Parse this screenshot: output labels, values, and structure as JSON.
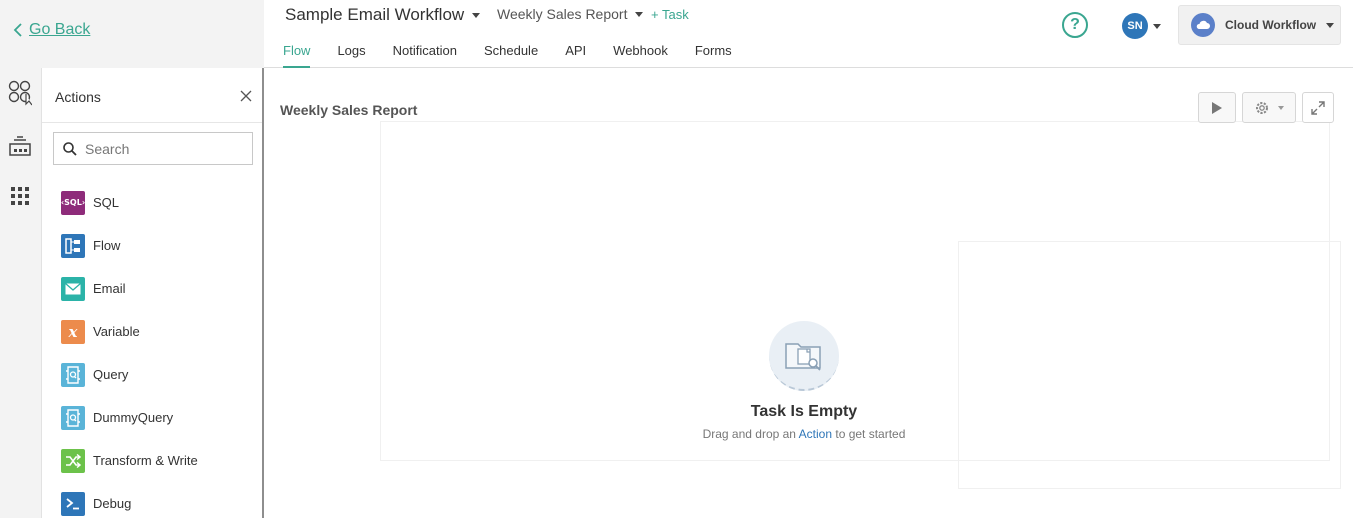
{
  "nav": {
    "go_back": "Go Back"
  },
  "header": {
    "workflow_title": "Sample Email Workflow",
    "report_selector": "Weekly Sales Report",
    "add_task": "+ Task",
    "tabs": [
      "Flow",
      "Logs",
      "Notification",
      "Schedule",
      "API",
      "Webhook",
      "Forms"
    ],
    "active_tab": "Flow",
    "help": "?",
    "user_initials": "SN",
    "cloud_label": "Cloud Workflow"
  },
  "actions_panel": {
    "title": "Actions",
    "search_placeholder": "Search",
    "items": [
      {
        "label": "SQL",
        "icon": "sql-icon",
        "color": "#8e2b7a"
      },
      {
        "label": "Flow",
        "icon": "flow-icon",
        "color": "#2e76b8"
      },
      {
        "label": "Email",
        "icon": "email-icon",
        "color": "#2bb3a8"
      },
      {
        "label": "Variable",
        "icon": "variable-icon",
        "color": "#ec8b4c"
      },
      {
        "label": "Query",
        "icon": "query-icon",
        "color": "#5ab4d8"
      },
      {
        "label": "DummyQuery",
        "icon": "dummy-query-icon",
        "color": "#5ab4d8"
      },
      {
        "label": "Transform & Write",
        "icon": "transform-icon",
        "color": "#6cc24a"
      },
      {
        "label": "Debug",
        "icon": "debug-icon",
        "color": "#2e76b8"
      }
    ]
  },
  "canvas": {
    "title": "Weekly Sales Report",
    "empty_title": "Task Is Empty",
    "empty_prefix": "Drag and drop an",
    "empty_link": "Action",
    "empty_suffix": "to get started"
  },
  "colors": {
    "accent": "#3aa690",
    "link": "#2e76b8"
  }
}
